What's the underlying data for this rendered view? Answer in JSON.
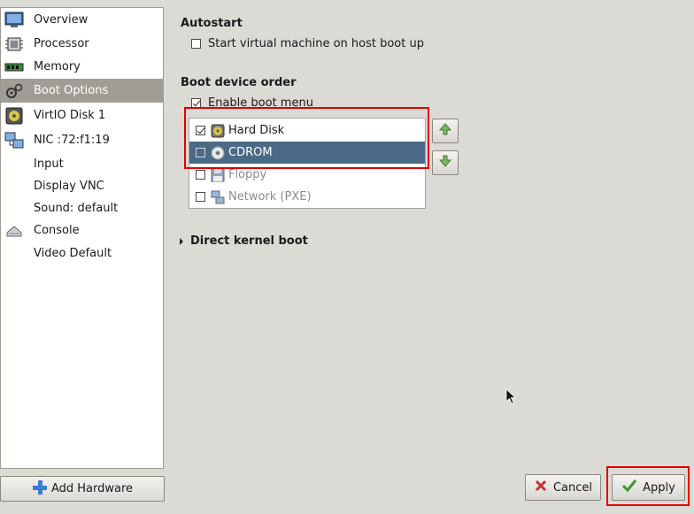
{
  "sidebar": {
    "items": [
      {
        "label": "Overview",
        "icon": "monitor-icon"
      },
      {
        "label": "Processor",
        "icon": "cpu-icon"
      },
      {
        "label": "Memory",
        "icon": "memory-icon"
      },
      {
        "label": "Boot Options",
        "icon": "gears-icon",
        "selected": true
      },
      {
        "label": "VirtIO Disk 1",
        "icon": "disk-icon"
      },
      {
        "label": "NIC :72:f1:19",
        "icon": "network-icon"
      },
      {
        "label": "Input",
        "icon": ""
      },
      {
        "label": "Display VNC",
        "icon": ""
      },
      {
        "label": "Sound: default",
        "icon": ""
      },
      {
        "label": "Console",
        "icon": "console-icon"
      },
      {
        "label": "Video Default",
        "icon": ""
      }
    ],
    "add_hardware_label": "Add Hardware"
  },
  "autostart": {
    "title": "Autostart",
    "checkbox_label": "Start virtual machine on host boot up",
    "checked": false
  },
  "boot_order": {
    "title": "Boot device order",
    "enable_menu_label": "Enable boot menu",
    "enable_menu_checked": true,
    "devices": [
      {
        "label": "Hard Disk",
        "checked": true,
        "icon": "harddisk-icon"
      },
      {
        "label": "CDROM",
        "checked": false,
        "icon": "cdrom-icon",
        "selected": true
      },
      {
        "label": "Floppy",
        "checked": false,
        "icon": "floppy-icon",
        "disabled": true
      },
      {
        "label": "Network (PXE)",
        "checked": false,
        "icon": "network-icon",
        "disabled": true
      }
    ]
  },
  "direct_kernel": {
    "title": "Direct kernel boot"
  },
  "buttons": {
    "cancel_label": "Cancel",
    "apply_label": "Apply"
  },
  "colors": {
    "selection": "#4b6a86",
    "highlight": "#e00000",
    "sidebar_selected": "#a09d96"
  }
}
